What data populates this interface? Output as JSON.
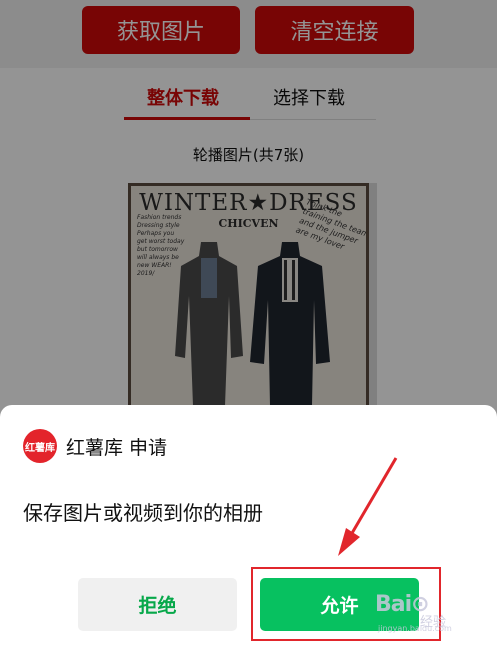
{
  "toolbar": {
    "fetch_label": "获取图片",
    "clear_label": "清空连接"
  },
  "tabs": [
    {
      "label": "整体下载",
      "active": true
    },
    {
      "label": "选择下载",
      "active": false
    }
  ],
  "carousel": {
    "title": "轮播图片(共7张)"
  },
  "poster": {
    "title": "WINTER★DRESS",
    "subtitle": "CHICVEN",
    "left_text": "Fashion trends Dressing style Perhaps you get worst today but tomorrow will always be new WEAR! 2019/",
    "right_text": "Think the training the team and the jumper are my lover"
  },
  "dialog": {
    "app_logo_text": "红薯库",
    "app_name": "红薯库  申请",
    "prompt": "保存图片或视频到你的相册",
    "deny_label": "拒绝",
    "allow_label": "允许"
  },
  "watermark": {
    "brand": "Bai⊙",
    "sub": "经验",
    "url": "jingyan.baidu.com"
  },
  "colors": {
    "accent_red": "#cf0a0a",
    "wechat_green": "#07c160",
    "annotation_red": "#e1262c"
  }
}
